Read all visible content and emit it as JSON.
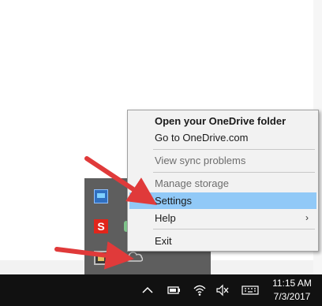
{
  "context_menu": {
    "items": [
      {
        "label": "Open your OneDrive folder",
        "bold": true
      },
      {
        "label": "Go to OneDrive.com"
      },
      {
        "label": "View sync problems",
        "disabled": true
      },
      {
        "label": "Manage storage",
        "disabled": true
      },
      {
        "label": "Settings",
        "selected": true
      },
      {
        "label": "Help",
        "has_submenu": true
      },
      {
        "label": "Exit"
      }
    ],
    "submenu_arrow": "›"
  },
  "tray_flyout": {
    "icons": [
      "network-icon",
      "snagit-icon",
      "green-status-icon",
      "media-icon",
      "onedrive-cloud-icon"
    ],
    "snagit_letter": "S"
  },
  "taskbar": {
    "time": "11:15 AM",
    "date": "7/3/2017",
    "icons": [
      "chevron-up-icon",
      "battery-icon",
      "wifi-icon",
      "volume-muted-icon",
      "keyboard-icon"
    ]
  },
  "colors": {
    "menu_background": "#f2f2f2",
    "menu_selected": "#91c9f7",
    "taskbar": "#111111",
    "flyout": "#5e5e5e",
    "arrow": "#e03a3a"
  }
}
